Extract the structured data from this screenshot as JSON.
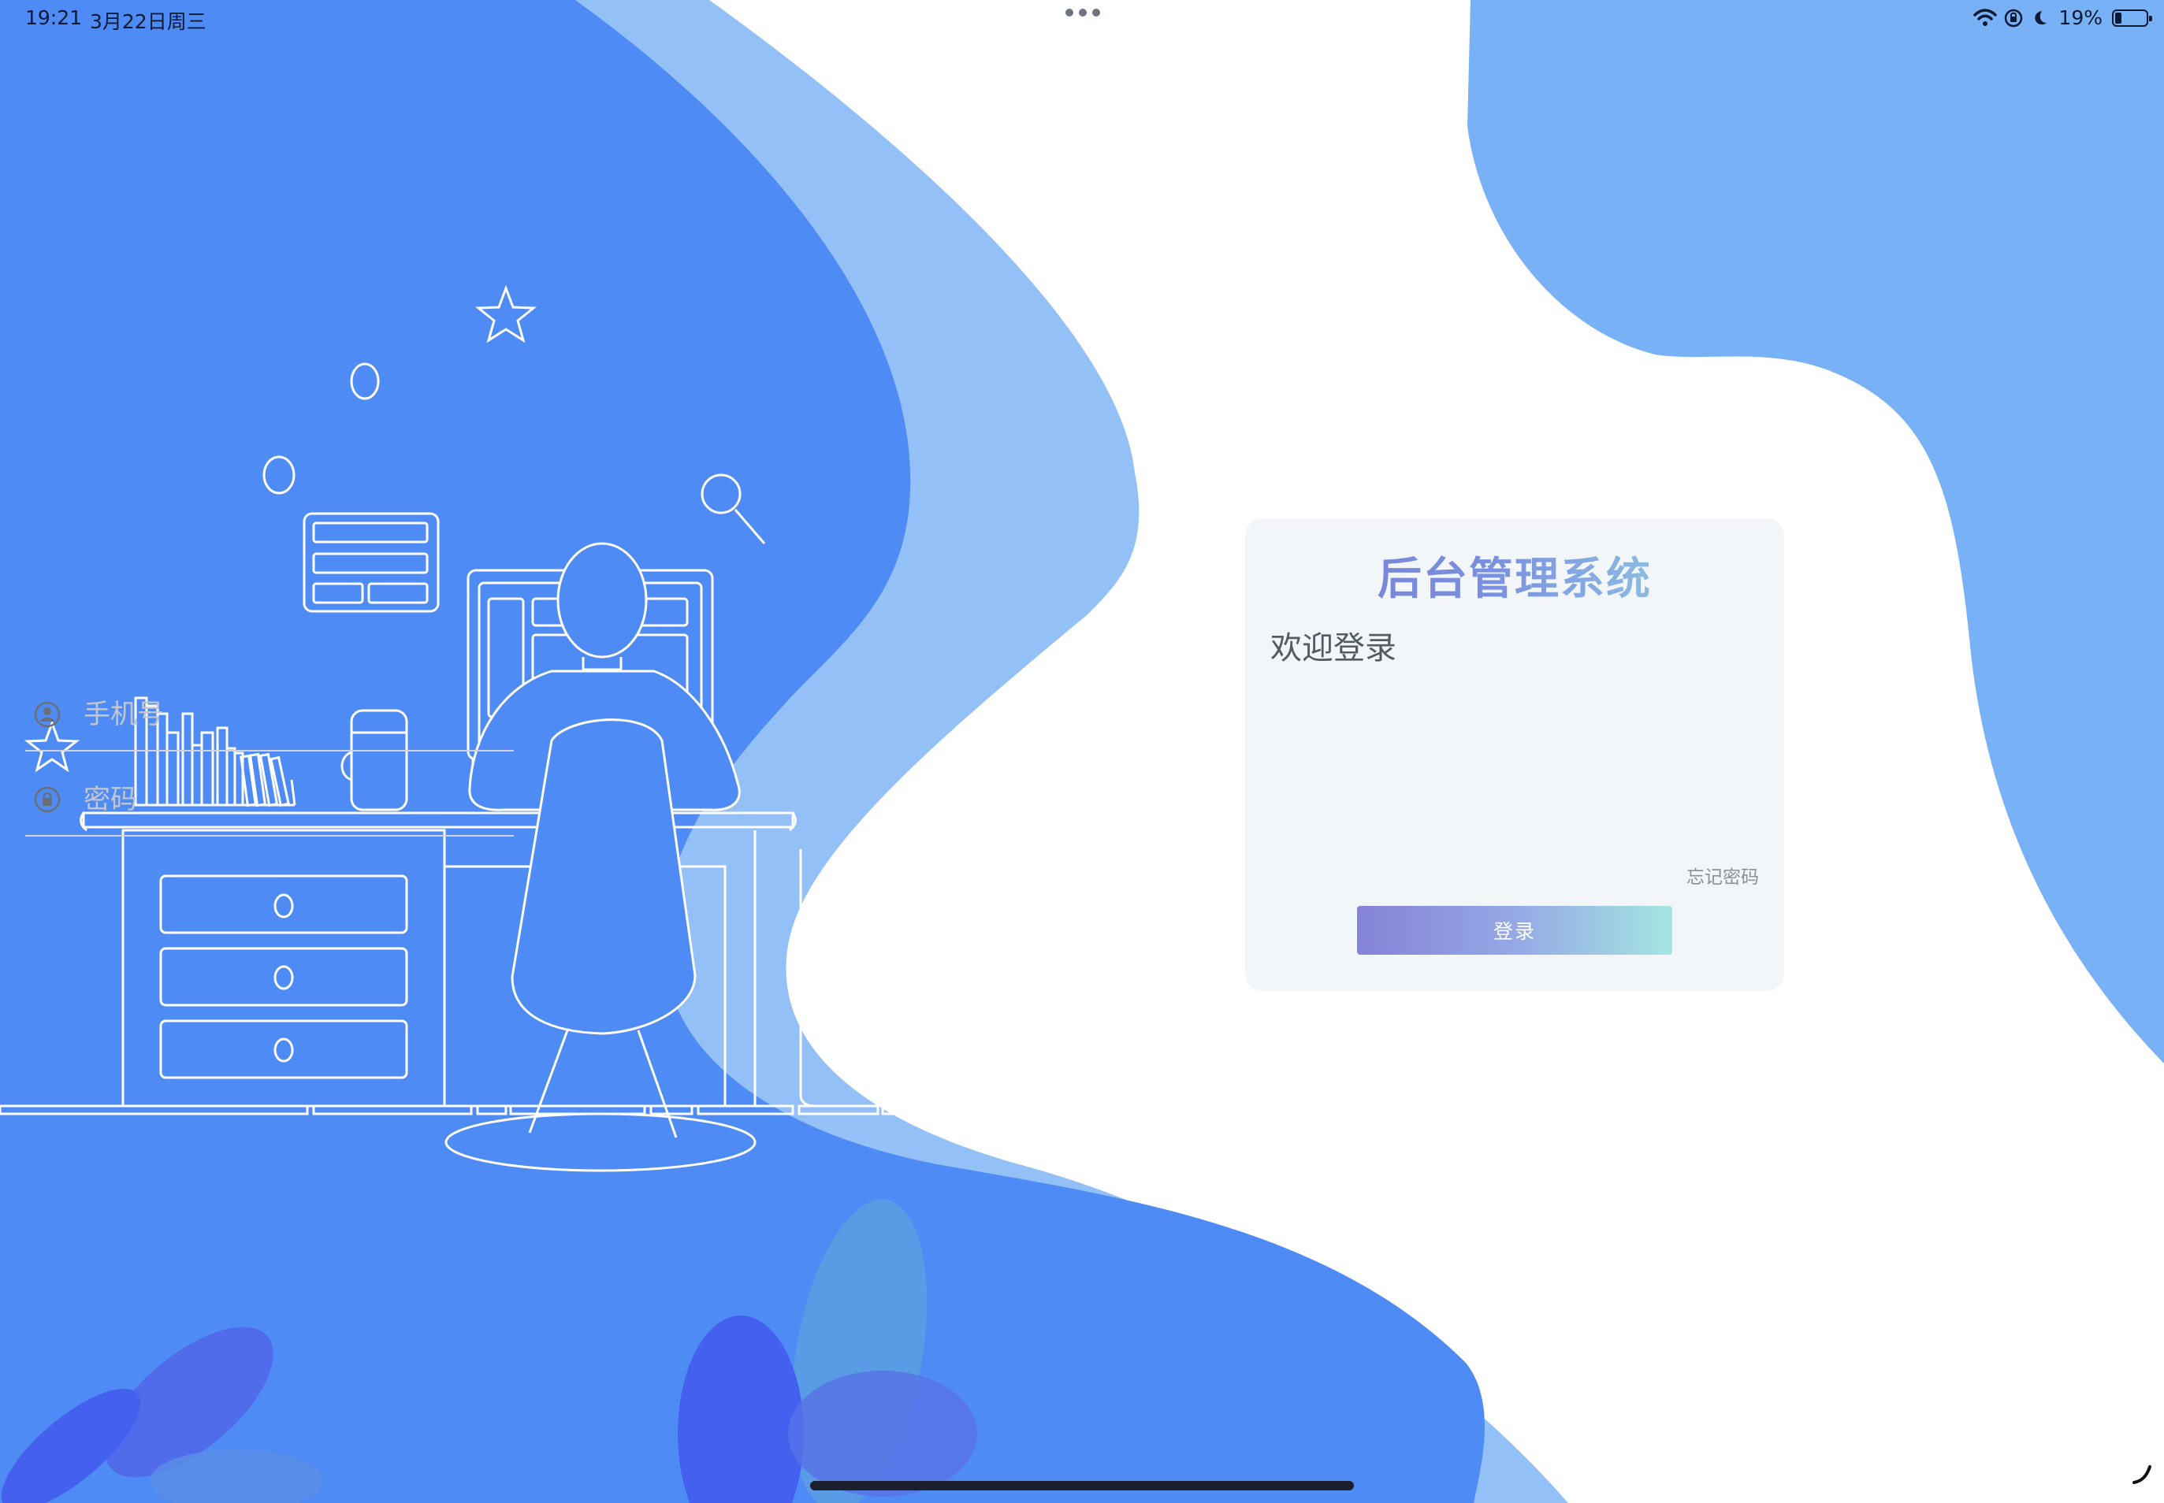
{
  "status_bar": {
    "time": "19:21",
    "date": "3月22日周三",
    "battery_percent": "19%",
    "icons": [
      "wifi-icon",
      "orientation-lock-icon",
      "moon-icon",
      "battery-icon"
    ]
  },
  "login": {
    "title": "后台管理系统",
    "welcome": "欢迎登录",
    "phone_placeholder": "手机号",
    "password_placeholder": "密码",
    "forgot_password": "忘记密码",
    "login_button": "登录"
  },
  "colors": {
    "primary_blue": "#4f8bf5",
    "light_blue": "#93c0f7",
    "accent_blue": "#78b1f5",
    "gradient_start": "#8583d6",
    "gradient_end": "#a5e6e1"
  }
}
